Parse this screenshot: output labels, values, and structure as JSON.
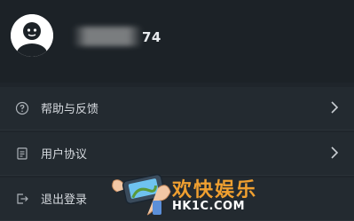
{
  "profile": {
    "username_visible": "74"
  },
  "menu": {
    "items": [
      {
        "label": "帮助与反馈",
        "icon": "help-circle-icon"
      },
      {
        "label": "用户协议",
        "icon": "document-icon"
      },
      {
        "label": "退出登录",
        "icon": "logout-icon"
      }
    ]
  },
  "watermark": {
    "title": "欢快娱乐",
    "subtitle": "HK1C.COM"
  },
  "colors": {
    "background": "#1f252b",
    "header": "#1c2227",
    "menu_item": "#232a30",
    "text": "#d5d9de",
    "watermark_orange": "#f0a030"
  }
}
